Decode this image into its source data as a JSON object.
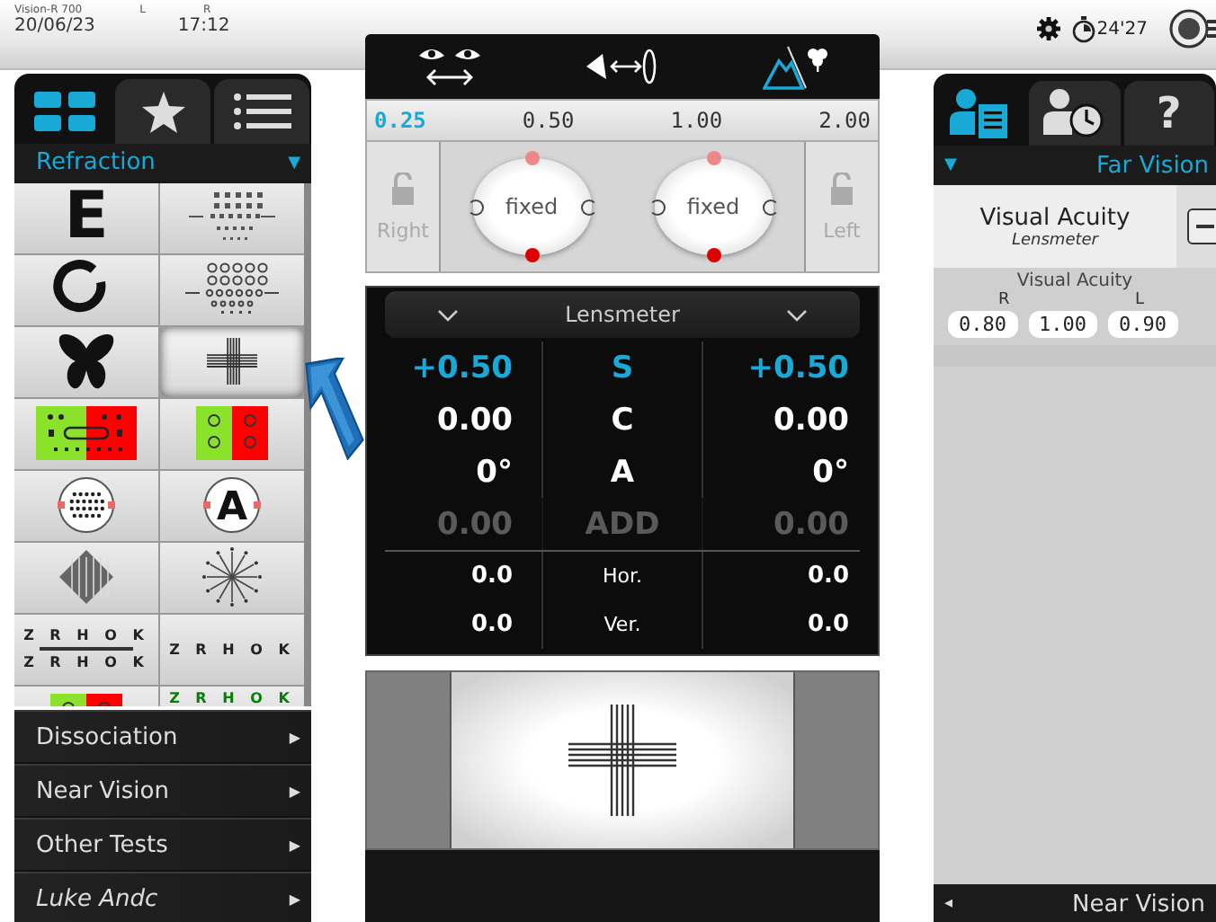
{
  "top_bar": {
    "device": "Vision-R 700",
    "eye_labels": [
      "L",
      "R"
    ],
    "date": "20/06/23",
    "time": "17:12",
    "timer": "24'27"
  },
  "left_panel": {
    "tabs": [
      {
        "kind": "grid",
        "selected": true
      },
      {
        "kind": "star",
        "selected": false
      },
      {
        "kind": "list",
        "selected": false
      }
    ],
    "section": "Refraction",
    "section_arrow": "▼",
    "charts": [
      {
        "kind": "letter",
        "text": "E",
        "selected": false
      },
      {
        "kind": "acuity_rows",
        "selected": false
      },
      {
        "kind": "landolt",
        "selected": false
      },
      {
        "kind": "landolt_rows",
        "selected": false
      },
      {
        "kind": "butterfly",
        "selected": false
      },
      {
        "kind": "cross",
        "selected": true
      },
      {
        "kind": "red_green_wide",
        "selected": false
      },
      {
        "kind": "red_green",
        "selected": false
      },
      {
        "kind": "dot_circle",
        "selected": false
      },
      {
        "kind": "circle_letter",
        "text": "A",
        "selected": false
      },
      {
        "kind": "diamond",
        "selected": false
      },
      {
        "kind": "fan",
        "selected": false
      },
      {
        "kind": "letter_rows",
        "lines": [
          "Z R H O K",
          "Z R H O K"
        ],
        "selected": false
      },
      {
        "kind": "letter_rows",
        "lines": [
          "Z R H O K"
        ],
        "selected": false
      },
      {
        "kind": "red_green",
        "selected": false
      },
      {
        "kind": "green_letters",
        "lines": [
          "Z R H O K"
        ],
        "selected": false
      }
    ],
    "menu": [
      {
        "label": "Dissociation",
        "kind": "category",
        "arrow": "▶"
      },
      {
        "label": "Near Vision",
        "kind": "category",
        "arrow": "▶"
      },
      {
        "label": "Other Tests",
        "kind": "category",
        "arrow": "▶"
      },
      {
        "label": "Luke Andc",
        "kind": "user",
        "arrow": "▶"
      }
    ]
  },
  "center_panel": {
    "modes": [
      {
        "kind": "binocular",
        "selected": false
      },
      {
        "kind": "eye_lens",
        "selected": false
      },
      {
        "kind": "far_near",
        "selected": true
      }
    ],
    "distances": [
      {
        "label": "0.25",
        "selected": true
      },
      {
        "label": "0.50",
        "selected": false
      },
      {
        "label": "1.00",
        "selected": false
      },
      {
        "label": "2.00",
        "selected": false
      }
    ],
    "occluders": [
      {
        "label": "Right",
        "disabled": true
      },
      {
        "label": "Left",
        "disabled": true
      }
    ],
    "knobs": [
      {
        "label": "fixed"
      },
      {
        "label": "fixed"
      }
    ],
    "lensmeter": {
      "title": "Lensmeter",
      "rows": [
        {
          "kind": "main",
          "label": "S",
          "values": [
            "+0.50",
            "+0.50"
          ],
          "selected": true,
          "disabled": false
        },
        {
          "kind": "main",
          "label": "C",
          "values": [
            "0.00",
            "0.00"
          ],
          "selected": false,
          "disabled": false
        },
        {
          "kind": "main",
          "label": "A",
          "values": [
            "0°",
            "0°"
          ],
          "selected": false,
          "disabled": false
        },
        {
          "kind": "main",
          "label": "ADD",
          "values": [
            "0.00",
            "0.00"
          ],
          "selected": false,
          "disabled": true
        },
        {
          "kind": "prism",
          "label": "Hor.",
          "values": [
            "0.0",
            "0.0"
          ],
          "selected": false,
          "disabled": false
        },
        {
          "kind": "prism",
          "label": "Ver.",
          "values": [
            "0.0",
            "0.0"
          ],
          "selected": false,
          "disabled": false
        }
      ]
    }
  },
  "right_panel": {
    "tabs": [
      {
        "kind": "patient_file",
        "selected": true
      },
      {
        "kind": "patient_history",
        "selected": false
      },
      {
        "kind": "help",
        "label": "?",
        "selected": false
      }
    ],
    "section_arrow": "▼",
    "section": "Far Vision",
    "test": {
      "title": "Visual Acuity",
      "subtitle": "Lensmeter"
    },
    "results": {
      "title": "Visual Acuity",
      "eyes": [
        "R",
        "L"
      ],
      "values": [
        "0.80",
        "1.00",
        "0.90"
      ]
    },
    "footer_arrow": "◂",
    "footer": "Near Vision"
  }
}
